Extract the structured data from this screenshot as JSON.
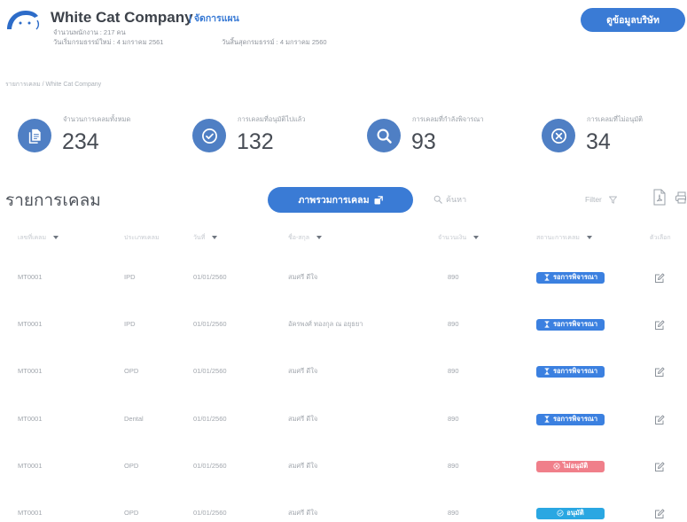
{
  "header": {
    "logo_icon": "white-cat-logo-icon",
    "company_name": "White Cat Company",
    "plan_link": "| จัดการแผน",
    "employee_count": "จำนวนพนักงาน : 217 คน",
    "policy_start": "วันเริ่มกรมธรรม์ใหม่ : 4 มกราคม 2561",
    "policy_end": "วันสิ้นสุดกรมธรรม์ : 4 มกราคม 2560",
    "company_info_button": "ดูข้อมูลบริษัท"
  },
  "breadcrumb": "รายการเคลม / White Cat Company",
  "stats": [
    {
      "icon": "document-icon",
      "label": "จำนวนการเคลมทั้งหมด",
      "value": 234
    },
    {
      "icon": "check-circle-icon",
      "label": "การเคลมที่อนุมัติไปแล้ว",
      "value": 132
    },
    {
      "icon": "search-icon",
      "label": "การเคลมที่กำลังพิจารณา",
      "value": 93
    },
    {
      "icon": "x-circle-icon",
      "label": "การเคลมที่ไม่อนุมัติ",
      "value": 34
    }
  ],
  "claims": {
    "title": "รายการเคลม",
    "overview_button": "ภาพรวมการเคลม",
    "search_placeholder": "ค้นหา",
    "filter_label": "Filter",
    "columns": [
      "เลขที่เคลม",
      "ประเภทเคลม",
      "วันที่",
      "ชื่อ-สกุล",
      "จำนวนเงิน",
      "สถานะการเคลม",
      "ตัวเลือก"
    ],
    "rows": [
      {
        "id": "MT0001",
        "type": "IPD",
        "date": "01/01/2560",
        "name": "สมศรี ดีใจ",
        "amount": 890,
        "status": {
          "label": "รอการพิจารณา",
          "icon": "hourglass-icon",
          "color": "#3b80e0"
        }
      },
      {
        "id": "MT0001",
        "type": "IPD",
        "date": "01/01/2560",
        "name": "อัครพงศ์ ทองกุล ณ อยุธยา",
        "amount": 890,
        "status": {
          "label": "รอการพิจารณา",
          "icon": "hourglass-icon",
          "color": "#3b80e0"
        }
      },
      {
        "id": "MT0001",
        "type": "OPD",
        "date": "01/01/2560",
        "name": "สมศรี ดีใจ",
        "amount": 890,
        "status": {
          "label": "รอการพิจารณา",
          "icon": "hourglass-icon",
          "color": "#3b80e0"
        }
      },
      {
        "id": "MT0001",
        "type": "Dental",
        "date": "01/01/2560",
        "name": "สมศรี ดีใจ",
        "amount": 890,
        "status": {
          "label": "รอการพิจารณา",
          "icon": "hourglass-icon",
          "color": "#3b80e0"
        }
      },
      {
        "id": "MT0001",
        "type": "OPD",
        "date": "01/01/2560",
        "name": "สมศรี ดีใจ",
        "amount": 890,
        "status": {
          "label": "ไม่อนุมัติ",
          "icon": "x-circle-icon",
          "color": "#f07f8a"
        }
      },
      {
        "id": "MT0001",
        "type": "OPD",
        "date": "01/01/2560",
        "name": "สมศรี ดีใจ",
        "amount": 890,
        "status": {
          "label": "อนุมัติ",
          "icon": "check-circle-icon",
          "color": "#2aa7e2"
        }
      }
    ]
  },
  "colors": {
    "primary": "#3a7bd5",
    "logo": "#2d6cc8",
    "stat_icon": "#4f7fc4"
  }
}
